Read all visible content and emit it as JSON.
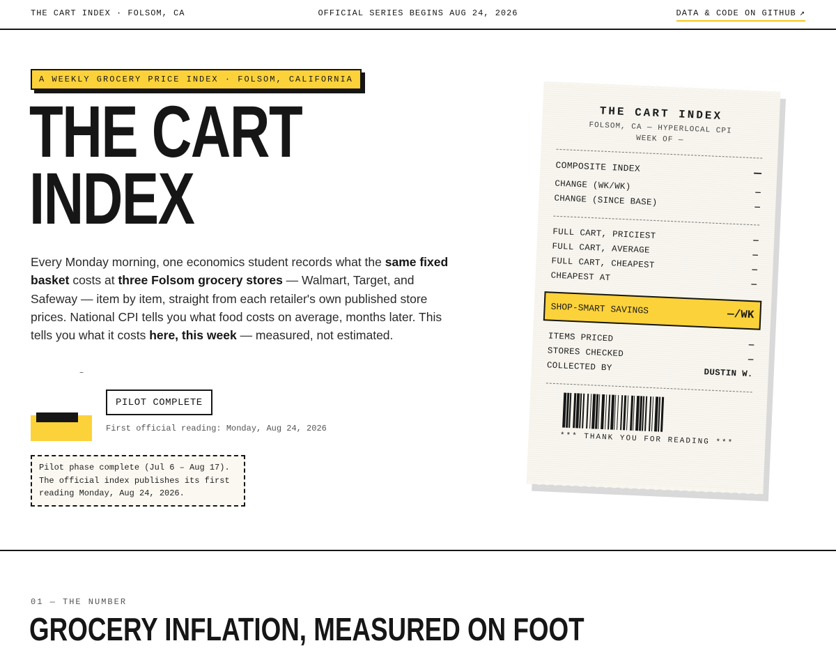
{
  "topbar": {
    "brand": "THE CART INDEX · FOLSOM, CA",
    "announcement": "OFFICIAL SERIES BEGINS AUG 24, 2026",
    "github_link": "DATA & CODE ON GITHUB",
    "github_icon": "external-arrow-icon"
  },
  "hero": {
    "eyebrow": "A WEEKLY GROCERY PRICE INDEX · FOLSOM, CALIFORNIA",
    "title_line1": "THE CART",
    "title_line2": "INDEX",
    "lede": {
      "p1": "Every Monday morning, one economics student records what the ",
      "b1": "same fixed basket",
      "p2": " costs at ",
      "b2": "three Folsom grocery stores",
      "p3": " — Walmart, Target, and Safeway — item by item, straight from each retailer's own published store prices. National CPI tells you what food costs on average, months later. This tells you what it costs ",
      "b3": "here, this week",
      "p4": " — measured, not estimated."
    },
    "tick_mark": "~",
    "status_badge": "PILOT COMPLETE",
    "first_reading": "First official reading: Monday, Aug 24, 2026",
    "note": "Pilot phase complete (Jul 6 – Aug 17). The official index publishes its first reading Monday, Aug 24, 2026."
  },
  "receipt": {
    "title": "THE CART INDEX",
    "subtitle": "FOLSOM, CA — HYPERLOCAL CPI",
    "week": "WEEK OF —",
    "composite_label": "COMPOSITE INDEX",
    "composite_value": "—",
    "change_wk_label": "CHANGE (WK/WK)",
    "change_wk_value": "—",
    "change_base_label": "CHANGE (SINCE BASE)",
    "change_base_value": "—",
    "priciest_label": "FULL CART, PRICIEST",
    "priciest_value": "—",
    "average_label": "FULL CART, AVERAGE",
    "average_value": "—",
    "cheapest_label": "FULL CART, CHEAPEST",
    "cheapest_value": "—",
    "cheapest_at_label": "CHEAPEST AT",
    "cheapest_at_value": "—",
    "savings_label": "SHOP-SMART SAVINGS",
    "savings_value": "—/WK",
    "items_label": "ITEMS PRICED",
    "items_value": "—",
    "stores_label": "STORES CHECKED",
    "stores_value": "—",
    "collected_label": "COLLECTED BY",
    "collected_value": "DUSTIN W.",
    "thanks": "*** THANK YOU FOR READING ***"
  },
  "section": {
    "kicker": "01 — THE NUMBER",
    "title": "GROCERY INFLATION, MEASURED ON FOOT"
  },
  "colors": {
    "accent": "#fcd23a",
    "ink": "#161616",
    "paper": "#f8f6ef"
  }
}
